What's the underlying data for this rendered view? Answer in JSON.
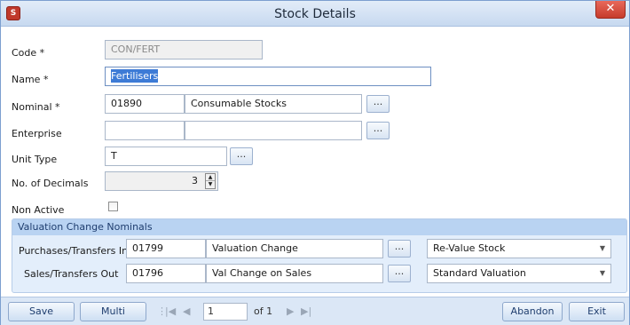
{
  "window": {
    "title": "Stock Details",
    "close_glyph": "✕",
    "app_icon": "stock-app-icon"
  },
  "form": {
    "code": {
      "label": "Code *",
      "value": "CON/FERT"
    },
    "name": {
      "label": "Name *",
      "value": "Fertilisers"
    },
    "nominal": {
      "label": "Nominal *",
      "code": "01890",
      "description": "Consumable Stocks"
    },
    "enterprise": {
      "label": "Enterprise",
      "code": "",
      "description": ""
    },
    "unit_type": {
      "label": "Unit Type",
      "value": "T"
    },
    "decimals": {
      "label": "No. of Decimals",
      "value": "3"
    },
    "non_active": {
      "label": "Non Active",
      "checked": false
    },
    "ellipsis": "..."
  },
  "valuation": {
    "header": "Valuation Change Nominals",
    "rows": [
      {
        "label": "Purchases/Transfers In",
        "code": "01799",
        "description": "Valuation Change",
        "option": "Re-Value Stock"
      },
      {
        "label": "Sales/Transfers Out",
        "code": "01796",
        "description": "Val Change on Sales",
        "option": "Standard Valuation"
      }
    ]
  },
  "footer": {
    "save": "Save",
    "multi": "Multi",
    "record_value": "1",
    "record_of": "of 1",
    "abandon": "Abandon",
    "exit": "Exit",
    "nav_first": "|◀",
    "nav_prev": "◀",
    "nav_next": "▶",
    "nav_last": "▶|"
  }
}
